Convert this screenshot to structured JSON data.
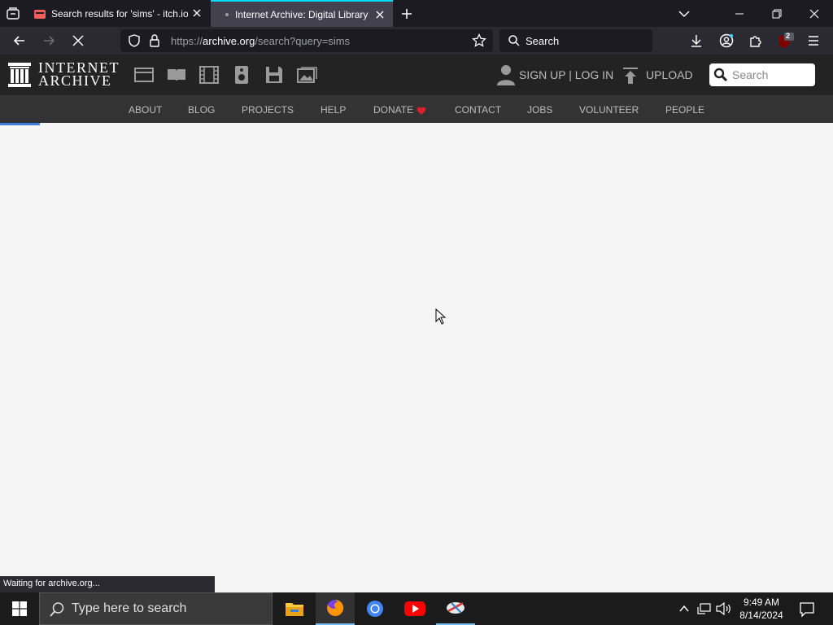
{
  "browser": {
    "tabs": [
      {
        "title": "Search results for 'sims' - itch.io",
        "active": false
      },
      {
        "title": "Internet Archive: Digital Library",
        "active": true
      }
    ],
    "url_scheme": "https://",
    "url_domain": "archive.org",
    "url_path": "/search?query=sims",
    "search_placeholder": "Search",
    "extension_badge": "2",
    "status_text": "Waiting for archive.org..."
  },
  "ia": {
    "logo_line1": "INTERNET",
    "logo_line2": "ARCHIVE",
    "signup_login": "SIGN UP | LOG IN",
    "upload": "UPLOAD",
    "search_placeholder": "Search",
    "nav": [
      "ABOUT",
      "BLOG",
      "PROJECTS",
      "HELP",
      "DONATE",
      "CONTACT",
      "JOBS",
      "VOLUNTEER",
      "PEOPLE"
    ],
    "accent": "#e01e2b"
  },
  "taskbar": {
    "search_placeholder": "Type here to search",
    "time": "9:49 AM",
    "date": "8/14/2024"
  }
}
